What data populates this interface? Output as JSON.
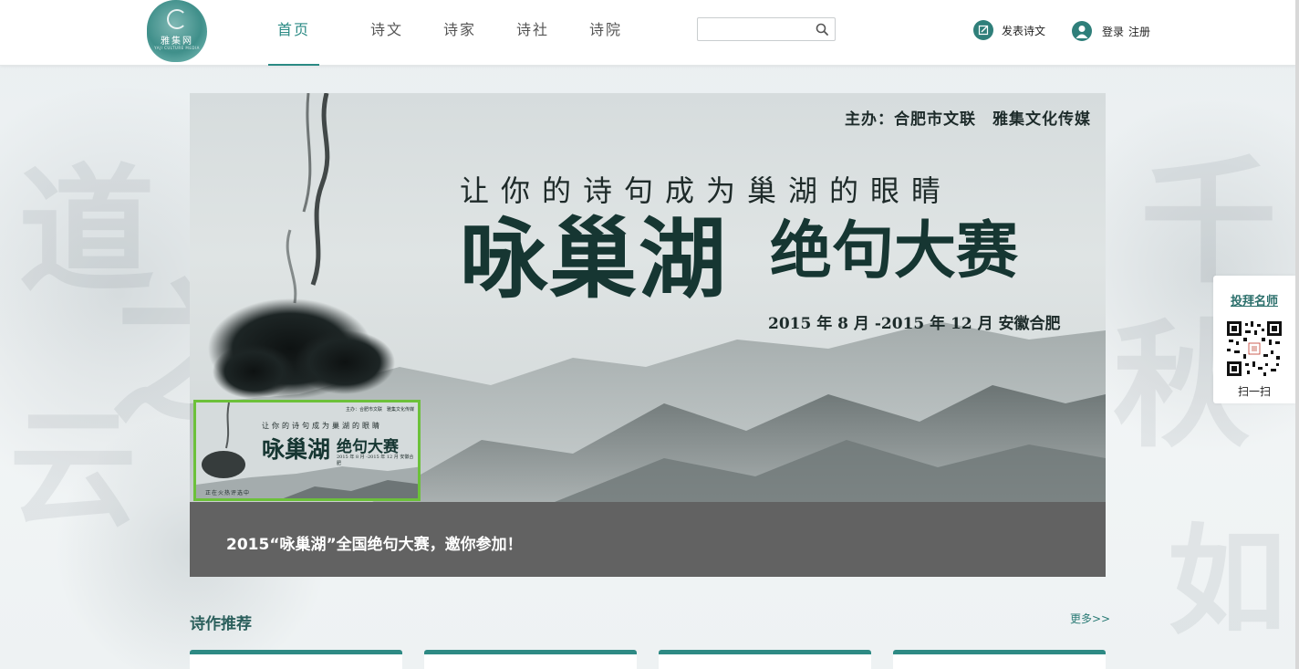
{
  "logo": {
    "text": "雅集网",
    "subtext": "YAJI CULTURE MEDIA"
  },
  "nav": {
    "items": [
      {
        "label": "首页",
        "active": true
      },
      {
        "label": "诗文",
        "active": false
      },
      {
        "label": "诗家",
        "active": false
      },
      {
        "label": "诗社",
        "active": false
      },
      {
        "label": "诗院",
        "active": false
      }
    ]
  },
  "search": {
    "placeholder": "",
    "value": ""
  },
  "header_actions": {
    "publish_label": "发表诗文",
    "login_label": "登录",
    "register_label": "注册"
  },
  "banner": {
    "sponsor": "主办：合肥市文联　雅集文化传媒",
    "slogan": "让你的诗句成为巢湖的眼睛",
    "main_title": "咏巢湖",
    "sub_title": "绝句大赛",
    "date": "2015 年 8 月 -2015 年 12 月 安徽合肥",
    "caption": "2015“咏巢湖”全国绝句大赛，邀你参加！"
  },
  "thumbnail": {
    "sponsor": "主办：合肥市文联　雅集文化传媒",
    "slogan": "让你的诗句成为巢湖的眼睛",
    "main_title": "咏巢湖",
    "sub_title": "绝句大赛",
    "date": "2015 年 8 月 -2015 年 12 月 安徽合肥",
    "footer": "正在火热评选中"
  },
  "section": {
    "title": "诗作推荐",
    "more_label": "更多>>"
  },
  "side_widget": {
    "title": "投拜名师",
    "scan_label": "扫一扫"
  },
  "colors": {
    "accent": "#2a8a84",
    "thumb_border": "#6cc13a",
    "caption_bg": "#626262"
  }
}
